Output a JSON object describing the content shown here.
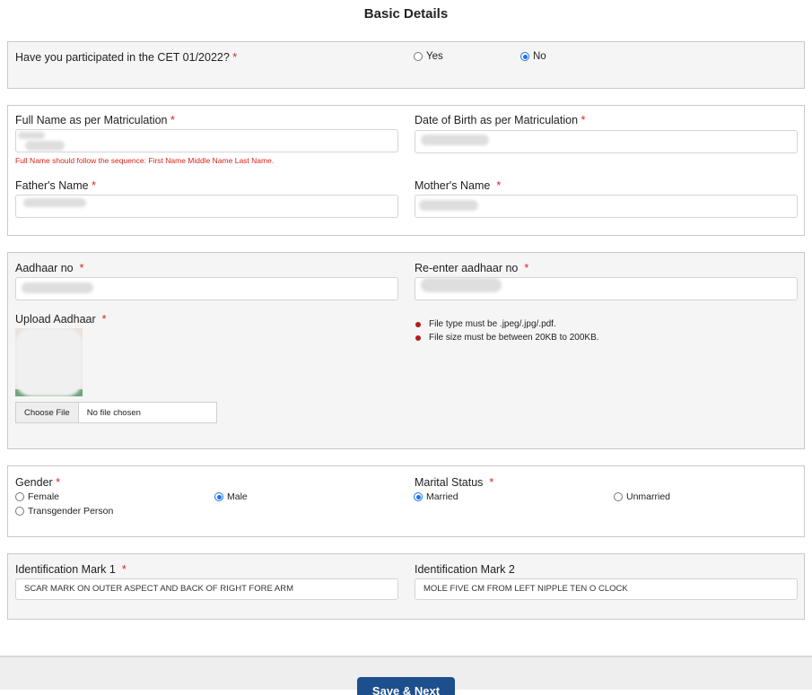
{
  "page_title": "Basic Details",
  "cet_section": {
    "question": "Have you participated in the CET 01/2022?",
    "required_mark": "*",
    "options": [
      {
        "label": "Yes",
        "checked": false
      },
      {
        "label": "No",
        "checked": true
      }
    ]
  },
  "name_section": {
    "full_name": {
      "label": "Full Name as per Matriculation",
      "required_mark": "*",
      "value": ""
    },
    "full_name_hint": "Full Name should follow the sequence: First Name Middle Name Last Name.",
    "dob": {
      "label": "Date of Birth as per Matriculation",
      "required_mark": "*",
      "value": ""
    },
    "father_name": {
      "label": "Father's Name",
      "required_mark": "*",
      "value": ""
    },
    "mother_name": {
      "label": "Mother's Name",
      "required_mark": "*",
      "value": ""
    }
  },
  "aadhaar_section": {
    "aadhaar_no": {
      "label": "Aadhaar no",
      "required_mark": "*",
      "value": ""
    },
    "reenter_aadhaar": {
      "label": "Re-enter aadhaar no",
      "required_mark": "*",
      "value": ""
    },
    "upload": {
      "label": "Upload Aadhaar",
      "required_mark": "*",
      "choose_file_label": "Choose File",
      "file_status": "No file chosen"
    },
    "rules": [
      "File type must be .jpeg/.jpg/.pdf.",
      "File size must be between 20KB to 200KB."
    ]
  },
  "gender_section": {
    "gender": {
      "label": "Gender",
      "required_mark": "*",
      "options": [
        {
          "label": "Female",
          "checked": false
        },
        {
          "label": "Male",
          "checked": true
        },
        {
          "label": "Transgender Person",
          "checked": false
        }
      ]
    },
    "marital_status": {
      "label": "Marital Status",
      "required_mark": "*",
      "options": [
        {
          "label": "Married",
          "checked": true
        },
        {
          "label": "Unmarried",
          "checked": false
        }
      ]
    }
  },
  "identification_section": {
    "mark1": {
      "label": "Identification Mark 1",
      "required_mark": "*",
      "value": "SCAR MARK ON OUTER ASPECT AND BACK OF RIGHT FORE ARM"
    },
    "mark2": {
      "label": "Identification Mark 2",
      "value": "MOLE FIVE CM FROM LEFT NIPPLE TEN O CLOCK"
    }
  },
  "footer": {
    "save_next_label": "Save & Next"
  },
  "colors": {
    "required": "#d9241c",
    "radio_checked": "#1a73e8",
    "primary_button": "#1d4f8d"
  }
}
